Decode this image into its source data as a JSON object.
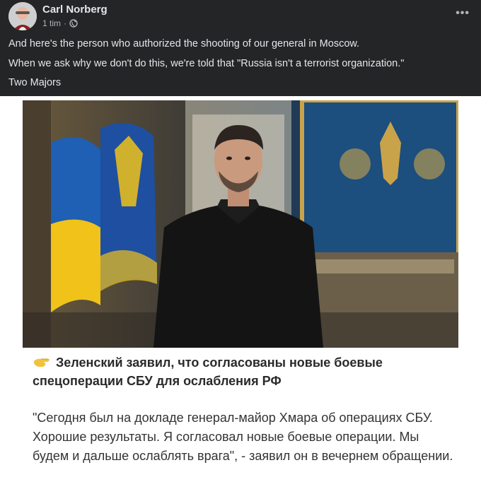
{
  "post": {
    "author": "Carl Norberg",
    "time": "1 tim",
    "separator": "·",
    "privacy_icon": "globe-icon",
    "more_icon": "ellipsis-icon",
    "more_label": "•••",
    "lines": [
      "And here's the person who authorized the shooting of our general in Moscow.",
      "When we ask why we don't do this, we're told that \"Russia isn't a terrorist organization.\"",
      "Two Majors"
    ]
  },
  "image": {
    "headline": "Зеленский заявил, что согласованы новые боевые спецоперации СБУ для ослабления РФ",
    "quote": "\"Сегодня был на докладе генерал-майор Хмара об операциях СБУ. Хорошие результаты. Я согласовал новые боевые операции. Мы будем и дальше ослаблять врага\", - заявил он в вечернем обращении.",
    "headline_icon": "pointing-hand-icon"
  },
  "colors": {
    "header_bg": "#242526",
    "text_primary": "#e4e6eb",
    "text_secondary": "#b0b3b8",
    "flag_blue": "#1f5fb4",
    "flag_yellow": "#f0c21a"
  }
}
